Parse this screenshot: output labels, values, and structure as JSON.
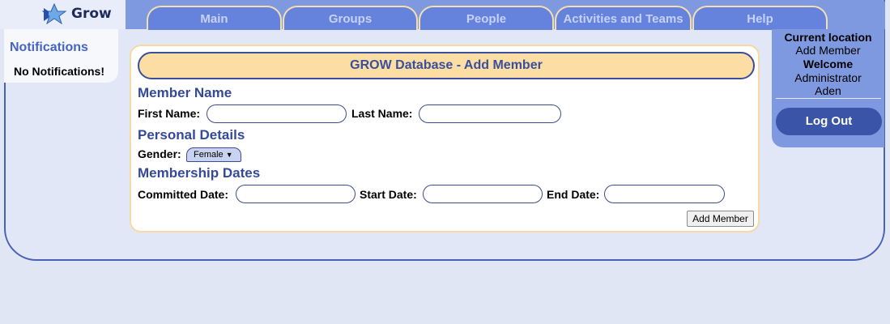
{
  "app": {
    "name": "Grow"
  },
  "tabs": [
    {
      "label": "Main"
    },
    {
      "label": "Groups"
    },
    {
      "label": "People"
    },
    {
      "label": "Activities and Teams"
    },
    {
      "label": "Help"
    }
  ],
  "notifications": {
    "title": "Notifications",
    "message": "No Notifications!"
  },
  "form": {
    "title": "GROW Database - Add Member",
    "sections": {
      "member_name": "Member Name",
      "personal_details": "Personal Details",
      "membership_dates": "Membership Dates"
    },
    "labels": {
      "first_name": "First Name:",
      "last_name": "Last Name:",
      "gender": "Gender:",
      "committed_date": "Committed Date:",
      "start_date": "Start Date:",
      "end_date": "End Date:"
    },
    "values": {
      "first_name": "",
      "last_name": "",
      "gender": "Female",
      "committed_date": "",
      "start_date": "",
      "end_date": ""
    },
    "submit_label": "Add Member"
  },
  "info_panel": {
    "location_label": "Current location",
    "location_value": "Add Member",
    "welcome_label": "Welcome",
    "user_role": "Administrator",
    "user_name": "Aden",
    "logout_label": "Log Out"
  },
  "colors": {
    "accent": "#4563c4",
    "tab_bg": "#6583dc",
    "header_bg": "#fcdda4",
    "logout_bg": "#3a55a8"
  }
}
